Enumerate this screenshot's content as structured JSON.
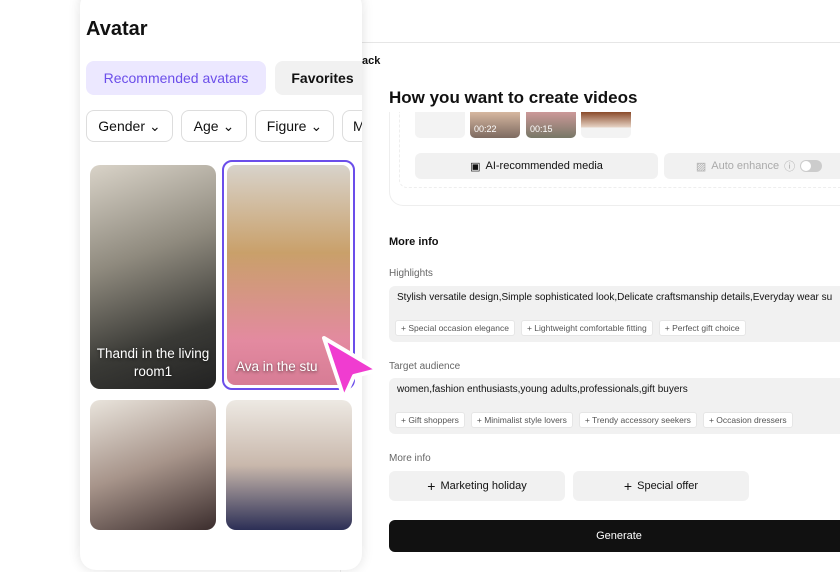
{
  "left": {
    "title": "Avatar",
    "tabs": [
      "Recommended avatars",
      "Favorites"
    ],
    "filters": [
      "Gender",
      "Age",
      "Figure",
      "M"
    ],
    "avatars": [
      {
        "name": "Thandi in the living room1"
      },
      {
        "name": "Ava in the stu"
      },
      {
        "name": ""
      },
      {
        "name": ""
      }
    ]
  },
  "right": {
    "back": "ack",
    "title": "How you want to create videos",
    "thumbs": [
      "00:22",
      "00:15"
    ],
    "ai_media": "AI-recommended media",
    "auto_enhance": "Auto enhance",
    "more_info_heading": "More info",
    "highlights_label": "Highlights",
    "highlights_value": "Stylish versatile design,Simple sophisticated look,Delicate craftsmanship details,Everyday wear su",
    "highlight_chips": [
      "+ Special occasion elegance",
      "+ Lightweight comfortable fitting",
      "+ Perfect gift choice"
    ],
    "audience_label": "Target audience",
    "audience_value": "women,fashion enthusiasts,young adults,professionals,gift buyers",
    "audience_chips": [
      "+ Gift shoppers",
      "+ Minimalist style lovers",
      "+ Trendy accessory seekers",
      "+ Occasion dressers"
    ],
    "more_info_label": "More info",
    "marketing": "Marketing holiday",
    "offer": "Special offer",
    "generate": "Generate"
  },
  "colors": {
    "accent": "#6b4eea",
    "tab_bg": "#ece8ff",
    "cursor": "#f03cd0"
  }
}
